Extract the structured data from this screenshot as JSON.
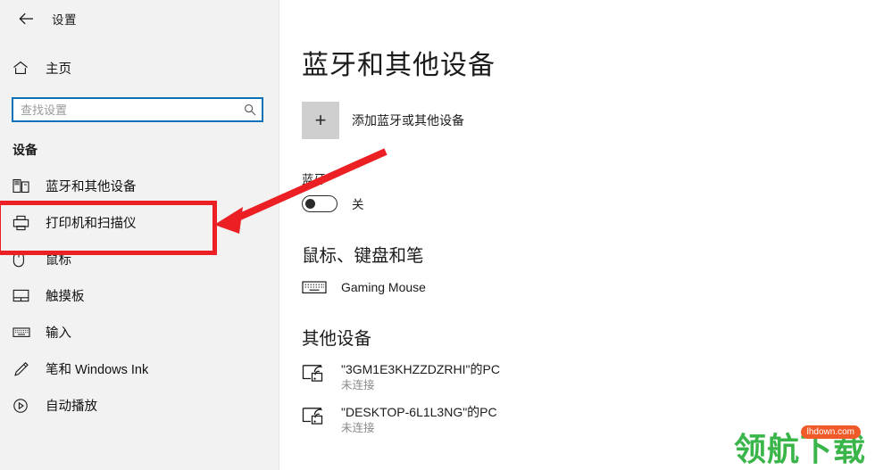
{
  "window": {
    "back_icon": "back-arrow-icon",
    "title": "设置"
  },
  "sidebar": {
    "home": {
      "label": "主页",
      "icon": "home-icon"
    },
    "search": {
      "placeholder": "查找设置",
      "value": "",
      "icon": "search-icon"
    },
    "group_title": "设备",
    "items": [
      {
        "label": "蓝牙和其他设备",
        "icon": "bluetooth-devices-icon",
        "selected": false
      },
      {
        "label": "打印机和扫描仪",
        "icon": "printer-icon",
        "selected": true
      },
      {
        "label": "鼠标",
        "icon": "mouse-icon",
        "selected": false
      },
      {
        "label": "触摸板",
        "icon": "touchpad-icon",
        "selected": false
      },
      {
        "label": "输入",
        "icon": "keyboard-icon",
        "selected": false
      },
      {
        "label": "笔和 Windows Ink",
        "icon": "pen-icon",
        "selected": false
      },
      {
        "label": "自动播放",
        "icon": "autoplay-icon",
        "selected": false
      }
    ]
  },
  "main": {
    "page_title": "蓝牙和其他设备",
    "add_device": {
      "label": "添加蓝牙或其他设备",
      "plus": "+"
    },
    "bluetooth": {
      "label": "蓝牙",
      "state": "关",
      "on": false
    },
    "mouse_keyboard_pen": {
      "heading": "鼠标、键盘和笔",
      "devices": [
        {
          "name": "Gaming Mouse",
          "icon": "keyboard-icon"
        }
      ]
    },
    "other_devices": {
      "heading": "其他设备",
      "devices": [
        {
          "name": "\"3GM1E3KHZZDZRHI\"的PC",
          "status": "未连接",
          "icon": "wireless-display-icon"
        },
        {
          "name": "\"DESKTOP-6L1L3NG\"的PC",
          "status": "未连接",
          "icon": "wireless-display-icon"
        }
      ]
    }
  },
  "annotations": {
    "highlight_color": "#ec2024",
    "highlight_target": "打印机和扫描仪",
    "arrow": "red-arrow-pointing-to-printers-and-scanners"
  },
  "watermark": {
    "text": "领航下载",
    "badge": "lhdown.com",
    "text_color": "#3ab54a",
    "badge_color": "#f05a28"
  }
}
